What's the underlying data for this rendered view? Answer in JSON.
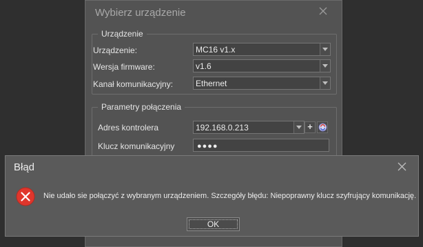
{
  "select_dialog": {
    "title": "Wybierz urządzenie",
    "device_group": {
      "legend": "Urządzenie",
      "device_label": "Urządzenie:",
      "device_value": "MC16 v1.x",
      "firmware_label": "Wersja firmware:",
      "firmware_value": "v1.6",
      "channel_label": "Kanał komunikacyjny:",
      "channel_value": "Ethernet"
    },
    "connection_group": {
      "legend": "Parametry połączenia",
      "address_label": "Adres kontrolera",
      "address_value": "192.168.0.213",
      "key_label": "Klucz komunikacyjny",
      "key_value": "●●●●"
    }
  },
  "error_dialog": {
    "title": "Błąd",
    "message": "Nie udało sie połączyć z wybranym urządzeniem. Szczegóły błędu: Niepoprawny klucz szyfrujący komunikację.",
    "ok_label": "OK"
  },
  "colors": {
    "error_red": "#e0362c",
    "dialog_bg": "#535353",
    "background": "#2f2f2f"
  },
  "icons": [
    "close-icon",
    "error-icon",
    "chevron-down-icon",
    "plus-icon",
    "refresh-icon"
  ]
}
